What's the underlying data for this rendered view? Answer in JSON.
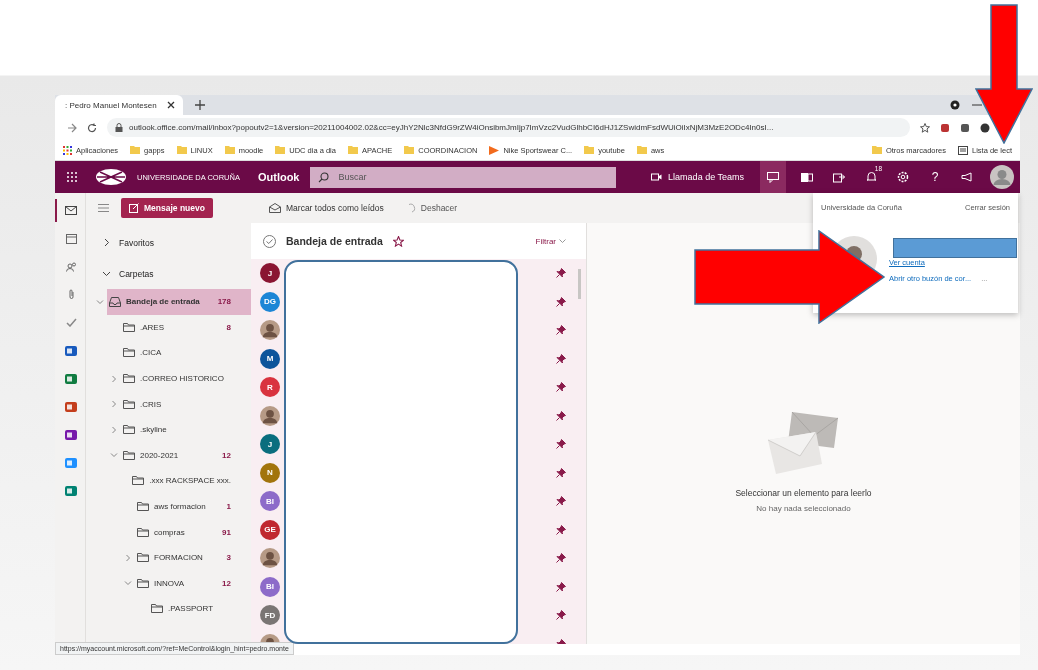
{
  "browser": {
    "tab_title": ": Pedro Manuel Montesen",
    "url": "outlook.office.com/mail/inbox?popoutv2=1&version=20211004002.02&cc=eyJhY2Nlc3NfdG9rZW4iOnsibmJmIjp7ImVzc2VudGlhbCI6dHJ1ZSwidmFsdWUiOiIxNjM3MzE2ODc4In0sI...",
    "bookmarks": [
      {
        "label": "Aplicaciones",
        "kind": "apps"
      },
      {
        "label": "gapps",
        "kind": "folder"
      },
      {
        "label": "LINUX",
        "kind": "folder"
      },
      {
        "label": "moodle",
        "kind": "folder"
      },
      {
        "label": "UDC dia a dia",
        "kind": "folder"
      },
      {
        "label": "APACHE",
        "kind": "folder"
      },
      {
        "label": "COORDINACION",
        "kind": "folder"
      },
      {
        "label": "Nike Sportswear C...",
        "kind": "site"
      },
      {
        "label": "youtube",
        "kind": "folder"
      },
      {
        "label": "aws",
        "kind": "folder"
      }
    ],
    "bookmarks_right": [
      {
        "label": "Otros marcadores",
        "kind": "folder"
      },
      {
        "label": "Lista de lect",
        "kind": "reading"
      }
    ],
    "status_url": "https://myaccount.microsoft.com/?ref=MeControl&login_hint=pedro.monte"
  },
  "header": {
    "org": "UNIVERSIDADE DA CORUÑA",
    "app": "Outlook",
    "search_placeholder": "Buscar",
    "teams_call": "Llamada de Teams",
    "notification_count": "18",
    "help": "?"
  },
  "toolbar": {
    "new_message": "Mensaje nuevo",
    "mark_all_read": "Marcar todos como leídos",
    "undo": "Deshacer"
  },
  "rail": [
    {
      "kind": "mail",
      "selected": true
    },
    {
      "kind": "calendar",
      "selected": false
    },
    {
      "kind": "people",
      "selected": false
    },
    {
      "kind": "attach",
      "selected": false
    },
    {
      "kind": "todo",
      "selected": false
    },
    {
      "kind": "word",
      "selected": false
    },
    {
      "kind": "excel",
      "selected": false
    },
    {
      "kind": "powerpoint",
      "selected": false
    },
    {
      "kind": "onenote",
      "selected": false
    },
    {
      "kind": "teams",
      "selected": false
    },
    {
      "kind": "sway",
      "selected": false
    }
  ],
  "sections": [
    {
      "label": "Favoritos",
      "expanded": false
    },
    {
      "label": "Carpetas",
      "expanded": true
    }
  ],
  "folders": [
    {
      "label": "Bandeja de entrada",
      "count": "178",
      "selected": true,
      "expanded": true,
      "kind": "inbox",
      "children": [
        {
          "label": ".ARES",
          "count": "8",
          "selected": false
        },
        {
          "label": ".CICA",
          "selected": false
        },
        {
          "label": ".CORREO HISTORICO",
          "selected": false,
          "expanded": false
        },
        {
          "label": ".CRIS",
          "selected": false,
          "expanded": false
        },
        {
          "label": ".skyline",
          "selected": false,
          "expanded": false
        },
        {
          "label": "2020-2021",
          "count": "12",
          "selected": false,
          "expanded": true,
          "children": [
            {
              "label": ".xxx RACKSPACE xxx.",
              "selected": false
            },
            {
              "label": "aws formacion",
              "count": "1",
              "selected": false
            },
            {
              "label": "compras",
              "count": "91",
              "selected": false
            },
            {
              "label": "FORMACION",
              "count": "3",
              "selected": false,
              "expanded": false
            },
            {
              "label": "INNOVA",
              "count": "12",
              "selected": false,
              "expanded": true,
              "children": [
                {
                  "label": ".PASSPORT",
                  "selected": false
                }
              ]
            }
          ]
        }
      ]
    }
  ],
  "message_list": {
    "title": "Bandeja de entrada",
    "filter": "Filtrar",
    "rows": [
      {
        "kind": "initials",
        "initials": "J",
        "color": "#8a1532"
      },
      {
        "kind": "initials",
        "initials": "DG",
        "color": "#1c86d6"
      },
      {
        "kind": "photo"
      },
      {
        "kind": "initials",
        "initials": "M",
        "color": "#0d559b"
      },
      {
        "kind": "initials",
        "initials": "R",
        "color": "#d9333f"
      },
      {
        "kind": "photo"
      },
      {
        "kind": "initials",
        "initials": "J",
        "color": "#0a6e7e"
      },
      {
        "kind": "initials",
        "initials": "N",
        "color": "#a2740c"
      },
      {
        "kind": "initials",
        "initials": "BI",
        "color": "#8d6bc9"
      },
      {
        "kind": "initials",
        "initials": "GE",
        "color": "#c0282f"
      },
      {
        "kind": "photo"
      },
      {
        "kind": "initials",
        "initials": "BI",
        "color": "#8d6bc9"
      },
      {
        "kind": "initials",
        "initials": "FD",
        "color": "#7a7574"
      },
      {
        "kind": "photo"
      }
    ]
  },
  "reading_pane": {
    "title": "Seleccionar un elemento para leerlo",
    "subtitle": "No hay nada seleccionado"
  },
  "account_menu": {
    "org": "Universidade da Coruña",
    "sign_out": "Cerrar sesión",
    "view_account": "Ver cuenta",
    "open_mailbox": "Abrir otro buzón de cor...",
    "more": "..."
  }
}
